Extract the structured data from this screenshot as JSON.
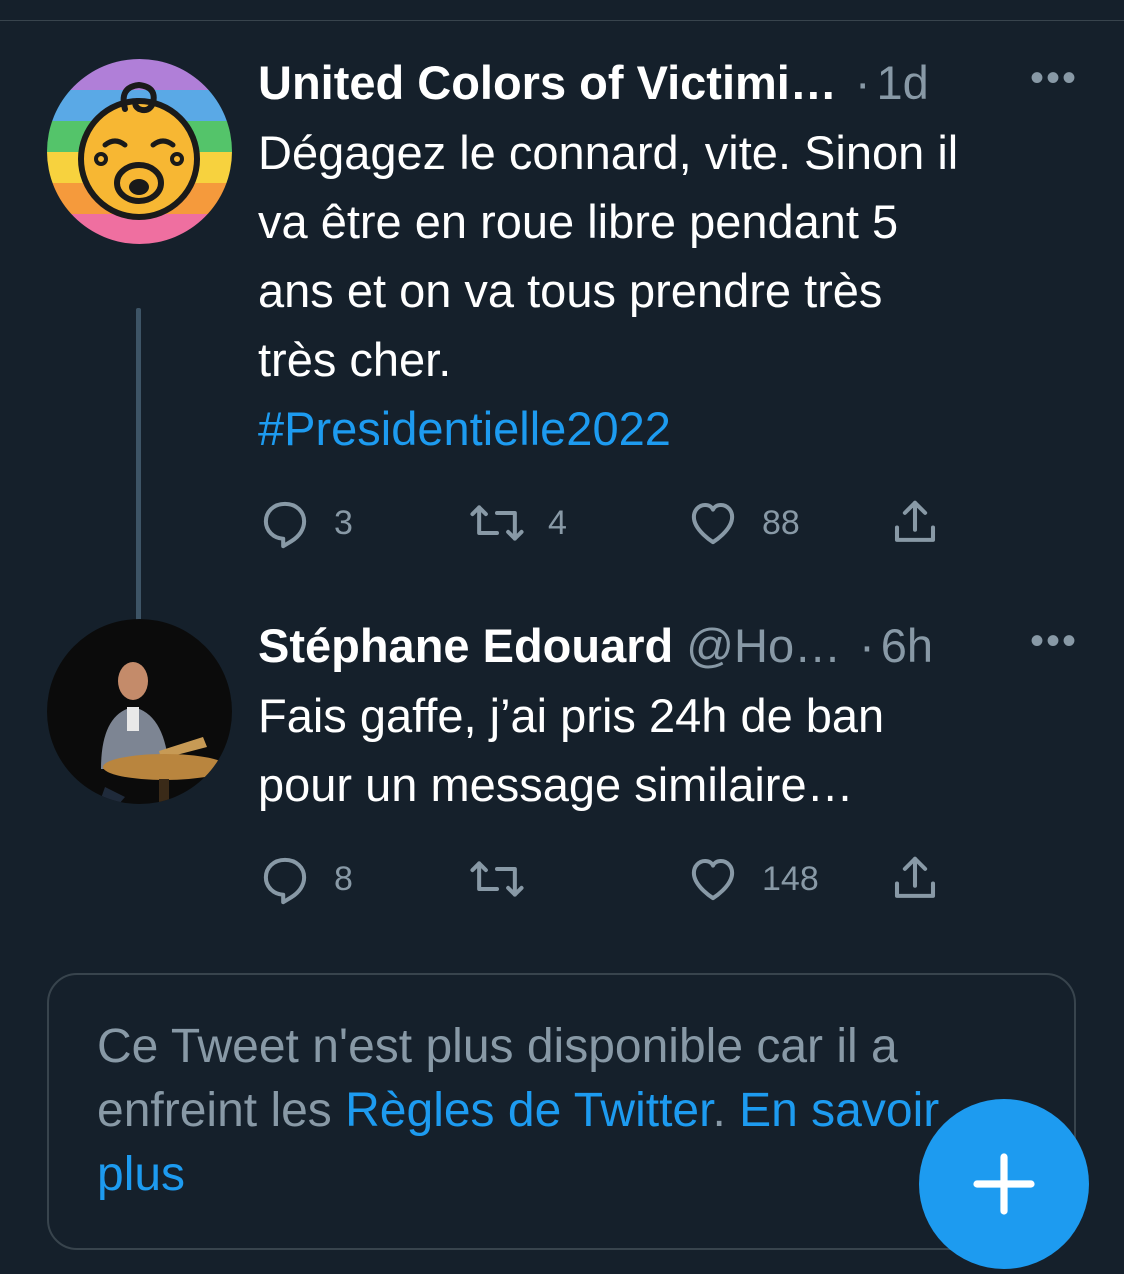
{
  "tweets": [
    {
      "name": "United Colors of Victimi…",
      "handle": "",
      "time": "1d",
      "text": "Dégagez le connard, vite. Sinon il\nva être en roue libre pendant 5\nans et on va tous prendre très\ntrès cher.",
      "hashtag": "#Presidentielle2022",
      "replies": "3",
      "retweets": "4",
      "likes": "88"
    },
    {
      "name": "Stéphane Edouard",
      "handle": "@Ho…",
      "time": "6h",
      "text": "Fais gaffe, j’ai pris 24h de ban\npour un message similaire…",
      "replies": "8",
      "retweets": "",
      "likes": "148"
    }
  ],
  "notice": {
    "text": "Ce Tweet n'est plus disponible car il a enfreint les ",
    "rules_link": "Règles de Twitter",
    "separator": ". ",
    "learn_more": "En savoir plus"
  },
  "icons": {
    "more": "more-icon",
    "reply": "reply-icon",
    "retweet": "retweet-icon",
    "like": "heart-icon",
    "share": "share-icon",
    "compose": "plus-icon"
  },
  "colors": {
    "background": "#15202b",
    "accent": "#1d9bf0",
    "secondary_text": "#8899a6",
    "border": "#38444d"
  }
}
